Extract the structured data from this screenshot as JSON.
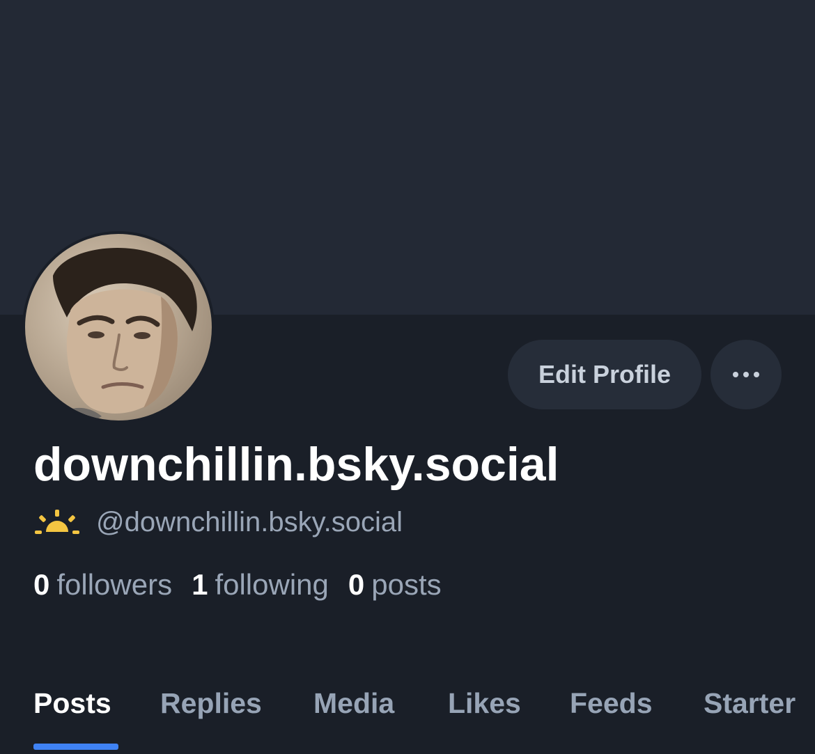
{
  "profile": {
    "display_name": "downchillin.bsky.social",
    "handle": "@downchillin.bsky.social",
    "handle_icon": "sunrise-emoji",
    "edit_button_label": "Edit Profile",
    "more_button_icon": "ellipsis-icon"
  },
  "stats": {
    "followers": {
      "count": "0",
      "label": "followers"
    },
    "following": {
      "count": "1",
      "label": "following"
    },
    "posts": {
      "count": "0",
      "label": "posts"
    }
  },
  "tabs": [
    {
      "label": "Posts",
      "active": true
    },
    {
      "label": "Replies",
      "active": false
    },
    {
      "label": "Media",
      "active": false
    },
    {
      "label": "Likes",
      "active": false
    },
    {
      "label": "Feeds",
      "active": false
    },
    {
      "label": "Starter",
      "active": false
    }
  ],
  "colors": {
    "background": "#1a1f28",
    "banner": "#232935",
    "button_bg": "#262d39",
    "muted_text": "#9aa6b7",
    "accent": "#3f82f4",
    "sun_icon": "#f4c542"
  }
}
